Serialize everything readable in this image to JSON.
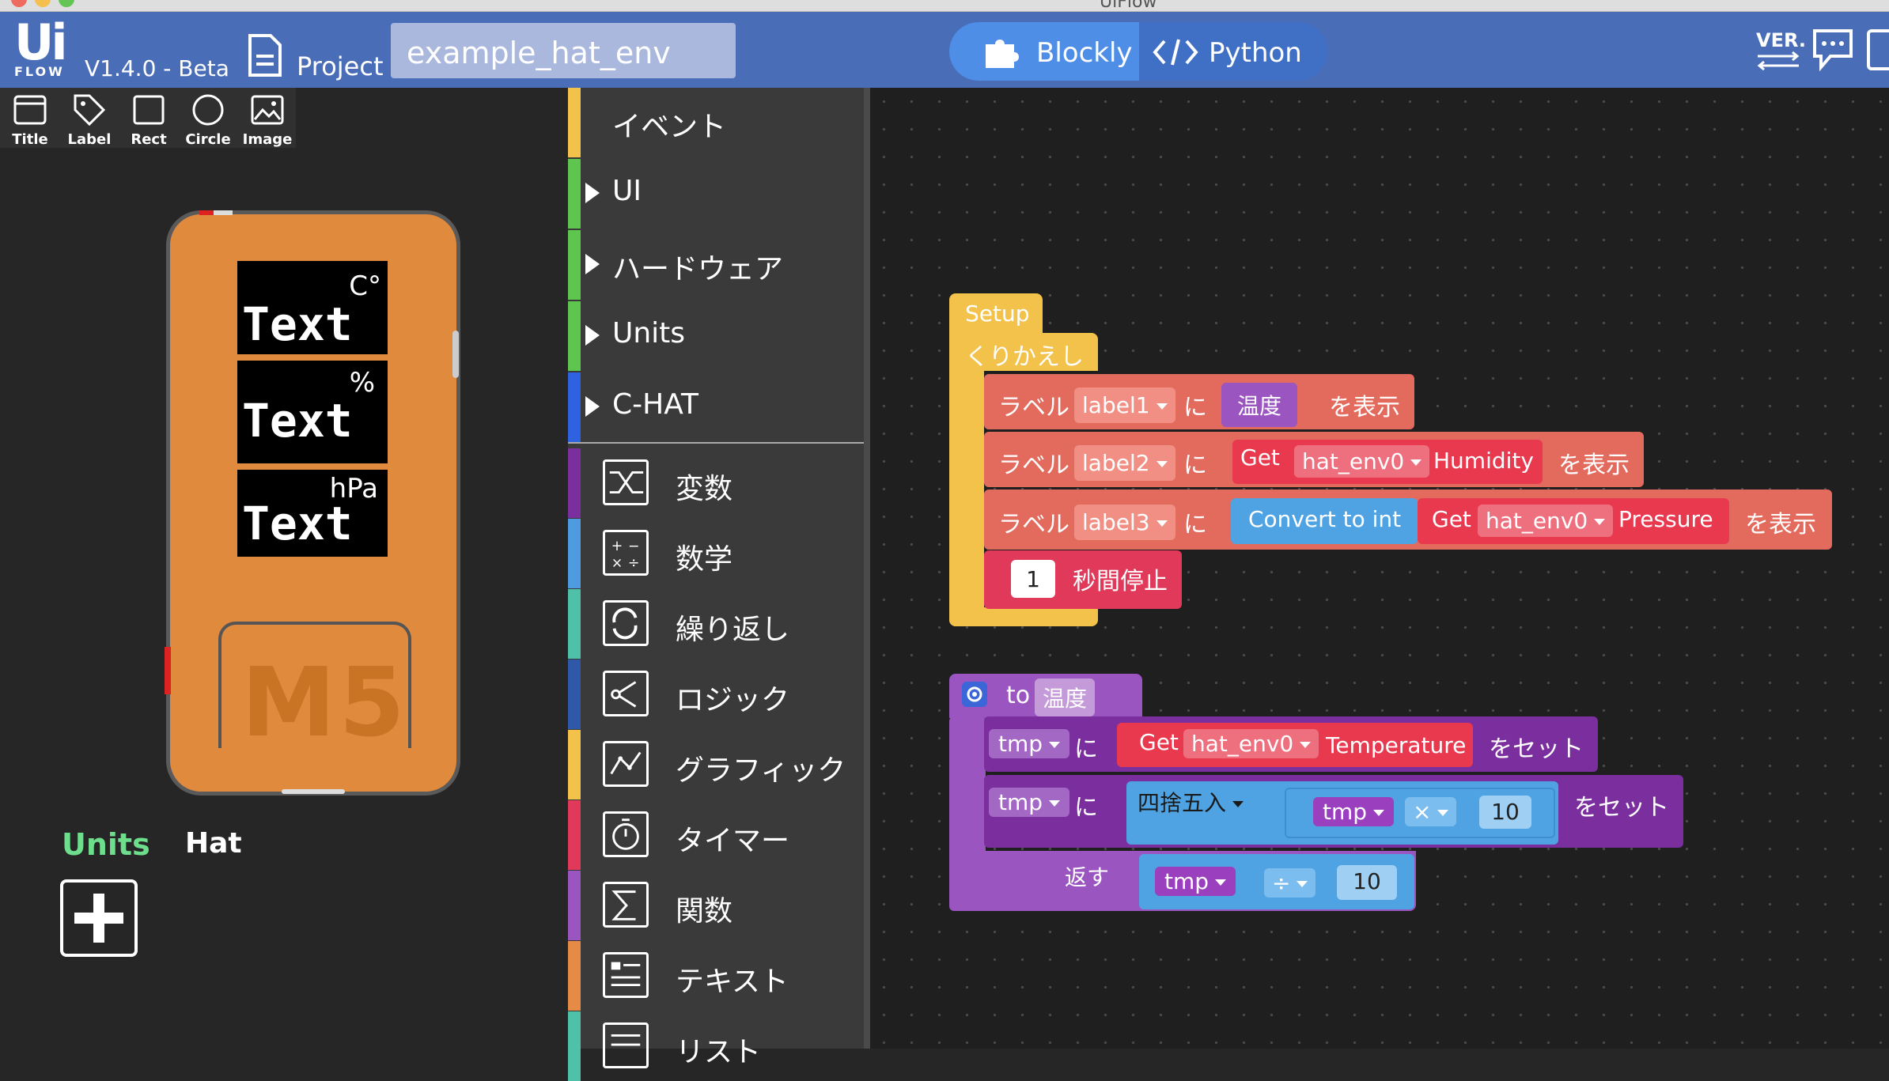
{
  "window": {
    "title": "UiFlow"
  },
  "header": {
    "logo_word": "Ui",
    "logo_sub": "FLOW",
    "version": "V1.4.0 - Beta",
    "project_label": "Project",
    "project_name": "example_hat_env",
    "mode_blockly": "Blockly",
    "mode_python": "Python",
    "ver_label": "VER."
  },
  "toolbar": {
    "items": [
      "Title",
      "Label",
      "Rect",
      "Circle",
      "Image"
    ]
  },
  "device": {
    "screens": [
      {
        "unit": "C°",
        "text": "Text"
      },
      {
        "unit": "%",
        "text": "Text"
      },
      {
        "unit": "hPa",
        "text": "Text"
      }
    ],
    "logo": "M5"
  },
  "units_panel": {
    "units_label": "Units",
    "hat_label": "Hat"
  },
  "categories": {
    "top": [
      {
        "label": "イベント",
        "color": "#f2c24b"
      },
      {
        "label": "UI",
        "color": "#5ec54f"
      },
      {
        "label": "ハードウェア",
        "color": "#5ec54f"
      },
      {
        "label": "Units",
        "color": "#5ec54f"
      },
      {
        "label": "C-HAT",
        "color": "#2f62e0"
      }
    ],
    "bottom": [
      {
        "label": "変数",
        "color": "#7b2f9e",
        "icon": "shuffle-icon"
      },
      {
        "label": "数学",
        "color": "#4f9be0",
        "icon": "math-icon"
      },
      {
        "label": "繰り返し",
        "color": "#4ec1a8",
        "icon": "loop-icon"
      },
      {
        "label": "ロジック",
        "color": "#2f58a8",
        "icon": "logic-icon"
      },
      {
        "label": "グラフィック",
        "color": "#f2c24b",
        "icon": "graphic-icon"
      },
      {
        "label": "タイマー",
        "color": "#e0395a",
        "icon": "timer-icon"
      },
      {
        "label": "関数",
        "color": "#9a55c0",
        "icon": "sigma-icon"
      },
      {
        "label": "テキスト",
        "color": "#e58b45",
        "icon": "text-icon"
      },
      {
        "label": "リスト",
        "color": "#4ec1a8",
        "icon": "list-icon"
      }
    ]
  },
  "blocks": {
    "setup": "Setup",
    "loop": "くりかえし",
    "label_kw": "ラベル",
    "ni": "に",
    "show": "を表示",
    "label1": "label1",
    "label2": "label2",
    "label3": "label3",
    "temp_func": "温度",
    "get": "Get",
    "hat_env": "hat_env0",
    "humidity": "Humidity",
    "convert_int": "Convert to int",
    "pressure": "Pressure",
    "wait_value": "1",
    "wait_label": "秒間停止",
    "to": "to",
    "func_name": "温度",
    "tmp": "tmp",
    "set": "をセット",
    "temperature": "Temperature",
    "round": "四捨五入",
    "times": "×",
    "ten": "10",
    "return": "返す",
    "divide": "÷"
  }
}
